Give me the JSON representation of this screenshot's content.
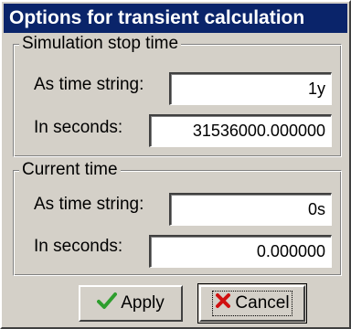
{
  "window": {
    "title": "Options for transient calculation"
  },
  "stop_group": {
    "legend": "Simulation stop time",
    "time_string_label": "As time string:",
    "time_string_value": "1y",
    "seconds_label": "In seconds:",
    "seconds_value": "31536000.000000"
  },
  "current_group": {
    "legend": "Current time",
    "time_string_label": "As time string:",
    "time_string_value": "0s",
    "seconds_label": "In seconds:",
    "seconds_value": "0.000000"
  },
  "buttons": {
    "apply_label": "Apply",
    "apply_icon": "check-icon",
    "cancel_label": "Cancel",
    "cancel_icon": "x-icon"
  },
  "colors": {
    "titlebar": "#0a246a",
    "face": "#d4d0c8",
    "apply_check": "#2e9e2e",
    "cancel_x": "#d01010"
  }
}
